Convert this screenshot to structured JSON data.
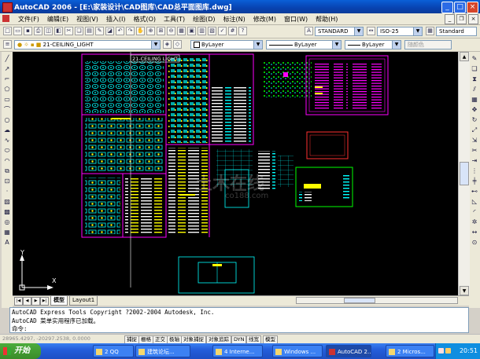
{
  "window": {
    "title": "AutoCAD 2006 - [E:\\家装设计\\CAD图库\\CAD总平面图库.dwg]",
    "minimize": "_",
    "maximize": "□",
    "close": "×"
  },
  "menu": [
    "文件(F)",
    "编辑(E)",
    "视图(V)",
    "插入(I)",
    "格式(O)",
    "工具(T)",
    "绘图(D)",
    "标注(N)",
    "修改(M)",
    "窗口(W)",
    "帮助(H)"
  ],
  "toolbar_styles": {
    "text_style": "STANDARD",
    "dim_style": "ISO-25",
    "table_style": "Standard"
  },
  "layer_toolbar": {
    "layer": "21-CEILING_LIGHT",
    "color": "ByLayer",
    "linetype": "ByLayer",
    "lineweight": "ByLayer",
    "plotstyle": "随颜色"
  },
  "drawing": {
    "block_label": "21-CEILING LIGHT",
    "ucs_y": "Y",
    "ucs_x": "X",
    "watermark": "土木在线",
    "watermark_url": "co188.com"
  },
  "layout_tabs": [
    "模型",
    "Layout1"
  ],
  "command": {
    "lines": [
      "AutoCAD Express Tools Copyright ?2002-2004 Autodesk, Inc.",
      "AutoCAD 菜单实用程序已加载。",
      "命令:"
    ]
  },
  "status": {
    "coords": "28965.4297, -20297.2538, 0.0000",
    "buttons": [
      "捕捉",
      "栅格",
      "正交",
      "极轴",
      "对象捕捉",
      "对象追踪",
      "DYN",
      "线宽",
      "模型"
    ]
  },
  "taskbar": {
    "start": "开始",
    "tasks": [
      "2 QQ",
      "建筑论坛...",
      "4 Interne...",
      "Windows ...",
      "AutoCAD 2...",
      "2 Micros..."
    ],
    "clock": "20:51"
  },
  "colors": {
    "drawing_bg": "#000000",
    "magenta": "#ff00ff",
    "cyan": "#00ffff",
    "yellow": "#ffff00",
    "green": "#00ff00",
    "red": "#ff0000"
  }
}
